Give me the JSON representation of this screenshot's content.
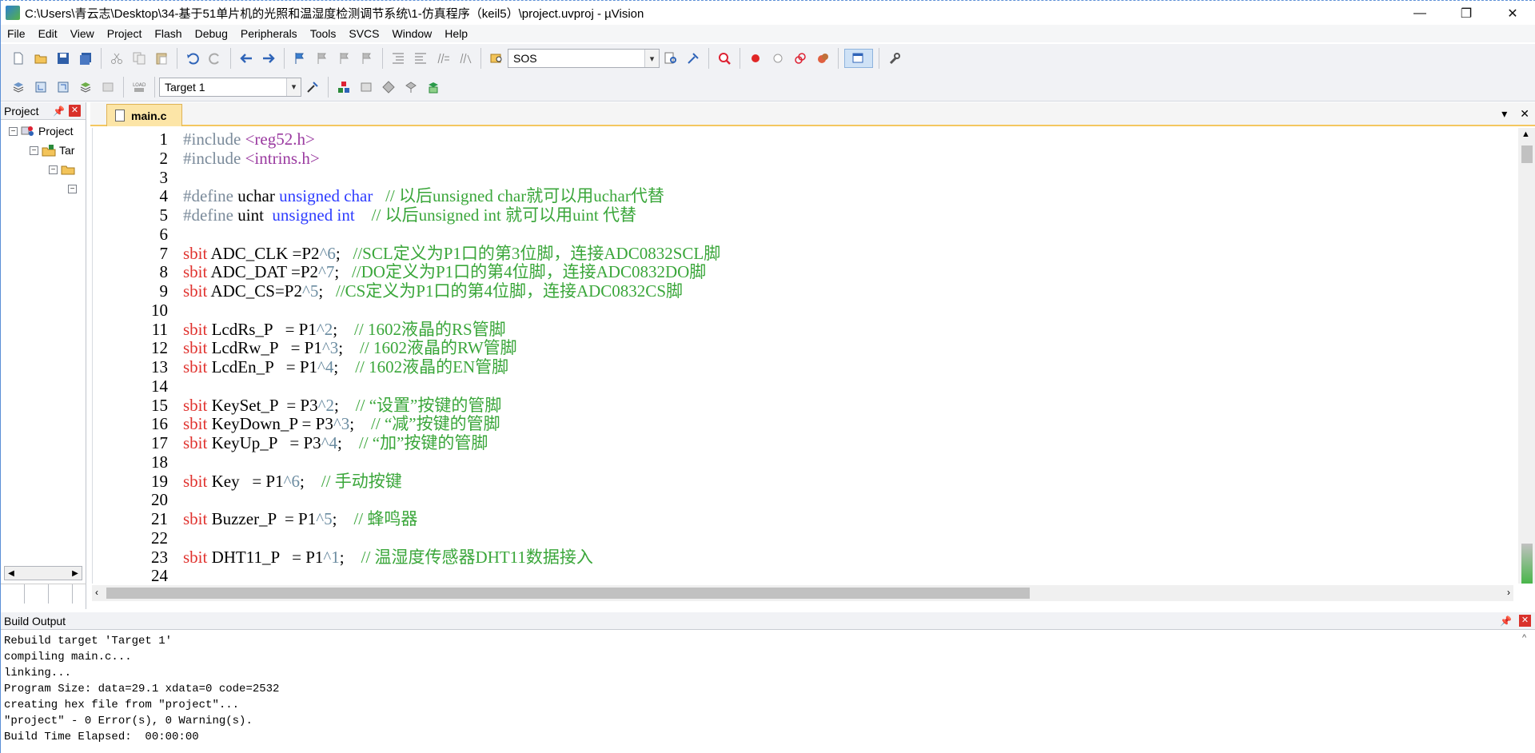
{
  "window": {
    "title": "C:\\Users\\青云志\\Desktop\\34-基于51单片机的光照和温湿度检测调节系统\\1-仿真程序（keil5）\\project.uvproj - µVision",
    "minimize": "—",
    "restore": "❐",
    "close": "✕"
  },
  "menu": [
    "File",
    "Edit",
    "View",
    "Project",
    "Flash",
    "Debug",
    "Peripherals",
    "Tools",
    "SVCS",
    "Window",
    "Help"
  ],
  "toolbar": {
    "find_value": "SOS",
    "target_value": "Target 1"
  },
  "project_panel": {
    "title": "Project",
    "pin": "📌",
    "close": "✕",
    "tree": [
      {
        "label": "Project",
        "toggle": "−"
      },
      {
        "label": "Tar",
        "toggle": "−"
      },
      {
        "label": "",
        "toggle": "−"
      },
      {
        "label": "",
        "toggle": "−"
      }
    ]
  },
  "editor": {
    "tab_label": "main.c",
    "dropdown": "▾",
    "close": "✕",
    "lines": [
      {
        "n": "1",
        "parts": [
          [
            "pp",
            "#include "
          ],
          [
            "inc",
            "<reg52.h>"
          ]
        ]
      },
      {
        "n": "2",
        "parts": [
          [
            "pp",
            "#include "
          ],
          [
            "inc",
            "<intrins.h>"
          ]
        ]
      },
      {
        "n": "3",
        "parts": []
      },
      {
        "n": "4",
        "parts": [
          [
            "pp",
            "#define "
          ],
          [
            "op",
            "uchar "
          ],
          [
            "type",
            "unsigned char"
          ],
          [
            "op",
            "   "
          ],
          [
            "cm",
            "// 以后unsigned char就可以用uchar代替"
          ]
        ]
      },
      {
        "n": "5",
        "parts": [
          [
            "pp",
            "#define "
          ],
          [
            "op",
            "uint  "
          ],
          [
            "type",
            "unsigned int"
          ],
          [
            "op",
            "    "
          ],
          [
            "cm",
            "// 以后unsigned int 就可以用uint 代替"
          ]
        ]
      },
      {
        "n": "6",
        "parts": []
      },
      {
        "n": "7",
        "parts": [
          [
            "red",
            "sbit "
          ],
          [
            "op",
            "ADC_CLK =P2"
          ],
          [
            "num",
            "^6"
          ],
          [
            "op",
            ";   "
          ],
          [
            "cm",
            "//SCL定义为P1口的第3位脚，连接ADC0832SCL脚"
          ]
        ]
      },
      {
        "n": "8",
        "parts": [
          [
            "red",
            "sbit "
          ],
          [
            "op",
            "ADC_DAT =P2"
          ],
          [
            "num",
            "^7"
          ],
          [
            "op",
            ";   "
          ],
          [
            "cm",
            "//DO定义为P1口的第4位脚，连接ADC0832DO脚"
          ]
        ]
      },
      {
        "n": "9",
        "parts": [
          [
            "red",
            "sbit "
          ],
          [
            "op",
            "ADC_CS=P2"
          ],
          [
            "num",
            "^5"
          ],
          [
            "op",
            ";   "
          ],
          [
            "cm",
            "//CS定义为P1口的第4位脚，连接ADC0832CS脚"
          ]
        ]
      },
      {
        "n": "10",
        "parts": []
      },
      {
        "n": "11",
        "parts": [
          [
            "red",
            "sbit "
          ],
          [
            "op",
            "LcdRs_P   = P1"
          ],
          [
            "num",
            "^2"
          ],
          [
            "op",
            ";    "
          ],
          [
            "cm",
            "// 1602液晶的RS管脚"
          ]
        ]
      },
      {
        "n": "12",
        "parts": [
          [
            "red",
            "sbit "
          ],
          [
            "op",
            "LcdRw_P   = P1"
          ],
          [
            "num",
            "^3"
          ],
          [
            "op",
            ";    "
          ],
          [
            "cm",
            "// 1602液晶的RW管脚"
          ]
        ]
      },
      {
        "n": "13",
        "parts": [
          [
            "red",
            "sbit "
          ],
          [
            "op",
            "LcdEn_P   = P1"
          ],
          [
            "num",
            "^4"
          ],
          [
            "op",
            ";    "
          ],
          [
            "cm",
            "// 1602液晶的EN管脚"
          ]
        ]
      },
      {
        "n": "14",
        "parts": []
      },
      {
        "n": "15",
        "parts": [
          [
            "red",
            "sbit "
          ],
          [
            "op",
            "KeySet_P  = P3"
          ],
          [
            "num",
            "^2"
          ],
          [
            "op",
            ";    "
          ],
          [
            "cm",
            "// “设置”按键的管脚"
          ]
        ]
      },
      {
        "n": "16",
        "parts": [
          [
            "red",
            "sbit "
          ],
          [
            "op",
            "KeyDown_P = P3"
          ],
          [
            "num",
            "^3"
          ],
          [
            "op",
            ";    "
          ],
          [
            "cm",
            "// “减”按键的管脚"
          ]
        ]
      },
      {
        "n": "17",
        "parts": [
          [
            "red",
            "sbit "
          ],
          [
            "op",
            "KeyUp_P   = P3"
          ],
          [
            "num",
            "^4"
          ],
          [
            "op",
            ";    "
          ],
          [
            "cm",
            "// “加”按键的管脚"
          ]
        ]
      },
      {
        "n": "18",
        "parts": []
      },
      {
        "n": "19",
        "parts": [
          [
            "red",
            "sbit "
          ],
          [
            "op",
            "Key   = P1"
          ],
          [
            "num",
            "^6"
          ],
          [
            "op",
            ";    "
          ],
          [
            "cm",
            "// 手动按键"
          ]
        ]
      },
      {
        "n": "20",
        "parts": []
      },
      {
        "n": "21",
        "parts": [
          [
            "red",
            "sbit "
          ],
          [
            "op",
            "Buzzer_P  = P1"
          ],
          [
            "num",
            "^5"
          ],
          [
            "op",
            ";    "
          ],
          [
            "cm",
            "// 蜂鸣器"
          ]
        ]
      },
      {
        "n": "22",
        "parts": []
      },
      {
        "n": "23",
        "parts": [
          [
            "red",
            "sbit "
          ],
          [
            "op",
            "DHT11_P   = P1"
          ],
          [
            "num",
            "^1"
          ],
          [
            "op",
            ";    "
          ],
          [
            "cm",
            "// 温湿度传感器DHT11数据接入"
          ]
        ]
      },
      {
        "n": "24",
        "parts": []
      }
    ]
  },
  "build_output": {
    "title": "Build Output",
    "pin": "📌",
    "close": "✕",
    "lines": [
      "Rebuild target 'Target 1'",
      "compiling main.c...",
      "linking...",
      "Program Size: data=29.1 xdata=0 code=2532",
      "creating hex file from \"project\"...",
      "\"project\" - 0 Error(s), 0 Warning(s).",
      "Build Time Elapsed:  00:00:00"
    ]
  }
}
